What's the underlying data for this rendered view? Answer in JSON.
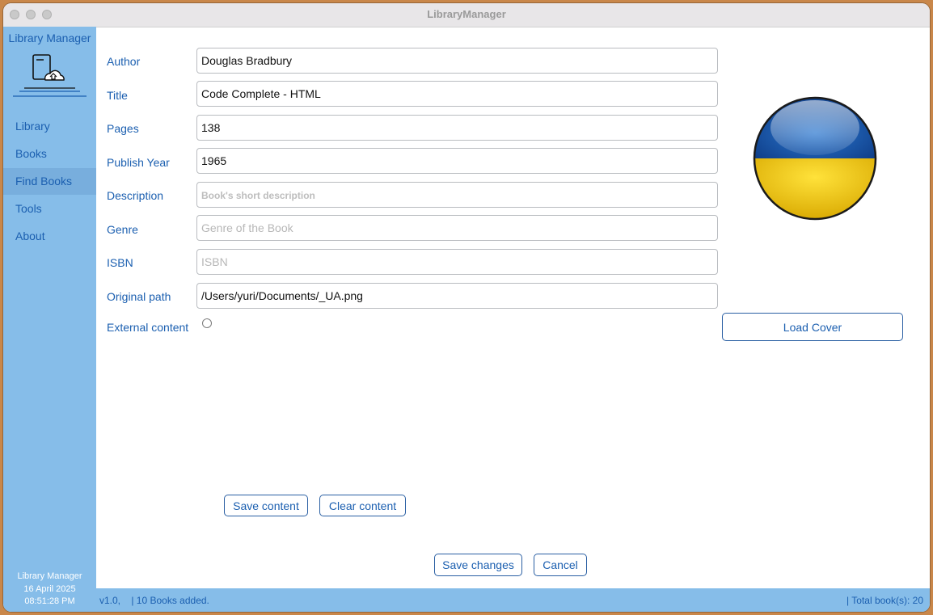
{
  "window": {
    "title": "LibraryManager"
  },
  "sidebar": {
    "app_name": "Library Manager",
    "logo_icon": "library-logo-icon",
    "items": [
      {
        "label": "Library",
        "active": false
      },
      {
        "label": "Books",
        "active": false
      },
      {
        "label": "Find Books",
        "active": true
      },
      {
        "label": "Tools",
        "active": false
      },
      {
        "label": "About",
        "active": false
      }
    ],
    "footer": {
      "app": "Library Manager",
      "date": "16 April 2025",
      "time": "08:51:28 PM"
    }
  },
  "form": {
    "author": {
      "label": "Author",
      "value": "Douglas Bradbury"
    },
    "title": {
      "label": "Title",
      "value": "Code Complete - HTML"
    },
    "pages": {
      "label": "Pages",
      "value": "138"
    },
    "publish_year": {
      "label": "Publish Year",
      "value": "1965"
    },
    "description": {
      "label": "Description",
      "value": "",
      "placeholder": "Book's short description"
    },
    "genre": {
      "label": "Genre",
      "value": "",
      "placeholder": "Genre of the Book"
    },
    "isbn": {
      "label": "ISBN",
      "value": "",
      "placeholder": "ISBN"
    },
    "original_path": {
      "label": "Original path",
      "value": "/Users/yuri/Documents/_UA.png"
    },
    "external_content": {
      "label": "External content",
      "checked": false
    }
  },
  "cover": {
    "icon": "ukraine-flag-button-icon",
    "colors": {
      "top": "#1f5fb8",
      "bottom": "#f6d200"
    }
  },
  "buttons": {
    "load_cover": "Load Cover",
    "save_content": "Save content",
    "clear_content": "Clear content",
    "save_changes": "Save changes",
    "cancel": "Cancel"
  },
  "status": {
    "version": "v1.0,",
    "books_added": "| 10 Books added.",
    "total": "| Total book(s): 20"
  },
  "colors": {
    "sidebar_bg": "#86bde9",
    "accent": "#1b5fb0",
    "active_item": "#78aedd"
  }
}
